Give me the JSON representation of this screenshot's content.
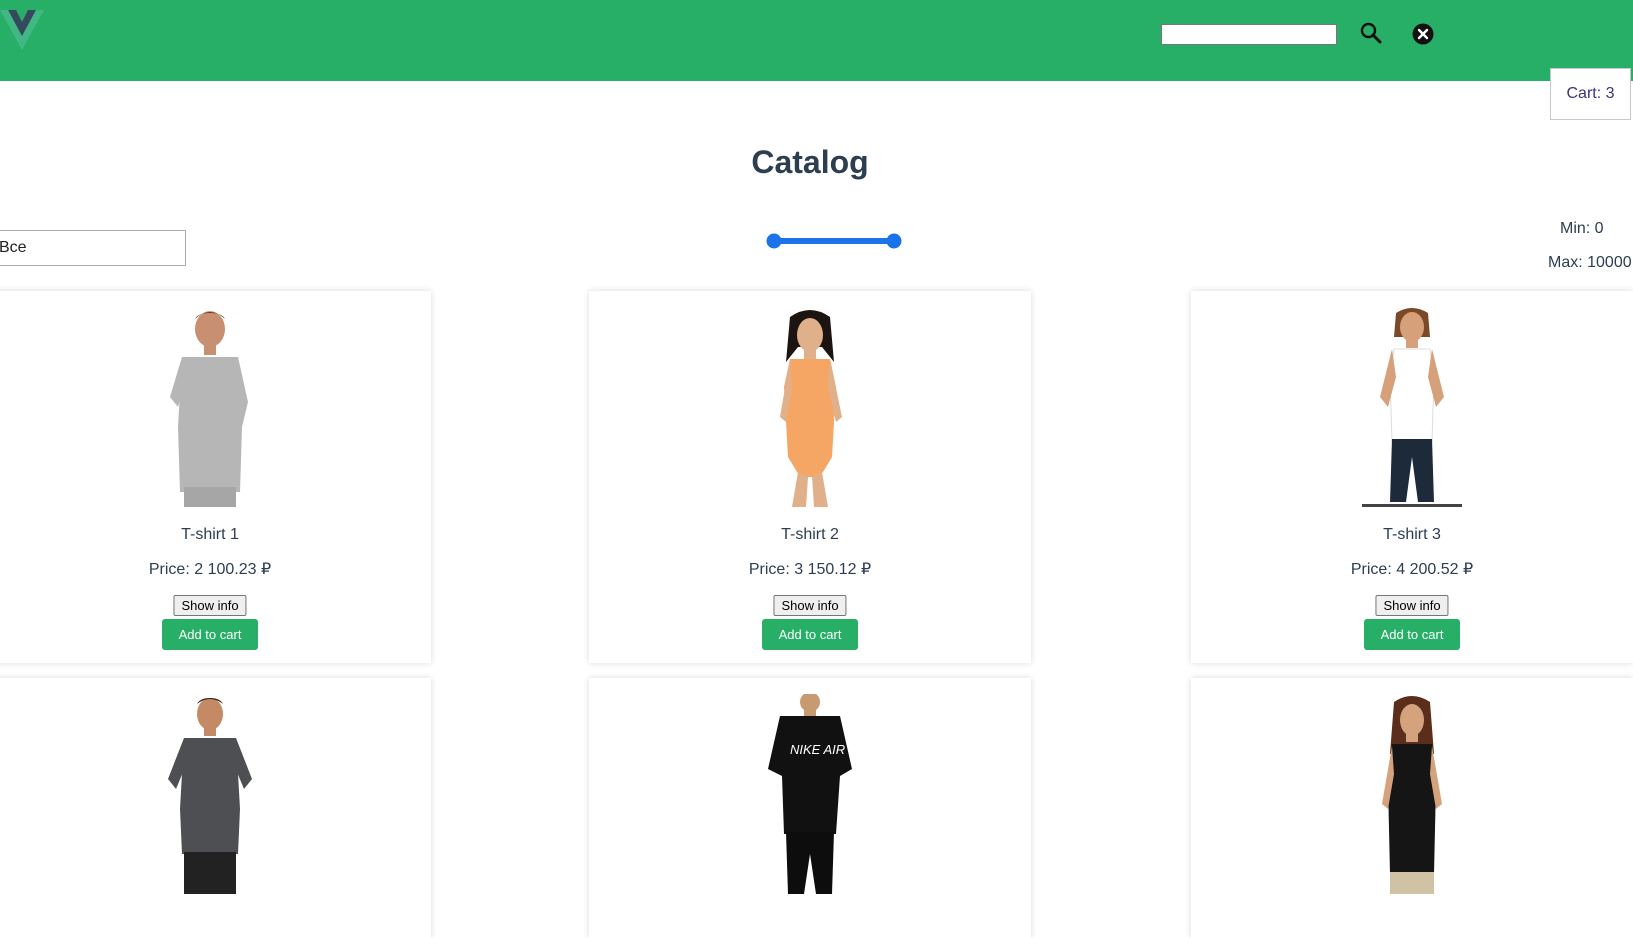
{
  "header": {
    "logo_icon": "vue-logo-icon",
    "search_value": "",
    "search_icon": "search-icon",
    "clear_icon": "close-circle-icon",
    "background_color": "#27ae67"
  },
  "cart": {
    "label": "Cart: 3"
  },
  "page": {
    "title": "Catalog"
  },
  "filters": {
    "category_value": "Все",
    "min_label": "Min: 0",
    "max_label": "Max: 10000",
    "slider_color": "#1a73e8"
  },
  "products": [
    {
      "name": "T-shirt 1",
      "price": "Price: 2 100.23 ₽",
      "info_label": "Show info",
      "cart_label": "Add to cart"
    },
    {
      "name": "T-shirt 2",
      "price": "Price: 3 150.12 ₽",
      "info_label": "Show info",
      "cart_label": "Add to cart"
    },
    {
      "name": "T-shirt 3",
      "price": "Price: 4 200.52 ₽",
      "info_label": "Show info",
      "cart_label": "Add to cart"
    },
    {
      "name": "",
      "price": "",
      "info_label": "",
      "cart_label": ""
    },
    {
      "name": "",
      "price": "",
      "info_label": "",
      "cart_label": ""
    },
    {
      "name": "",
      "price": "",
      "info_label": "",
      "cart_label": ""
    }
  ]
}
